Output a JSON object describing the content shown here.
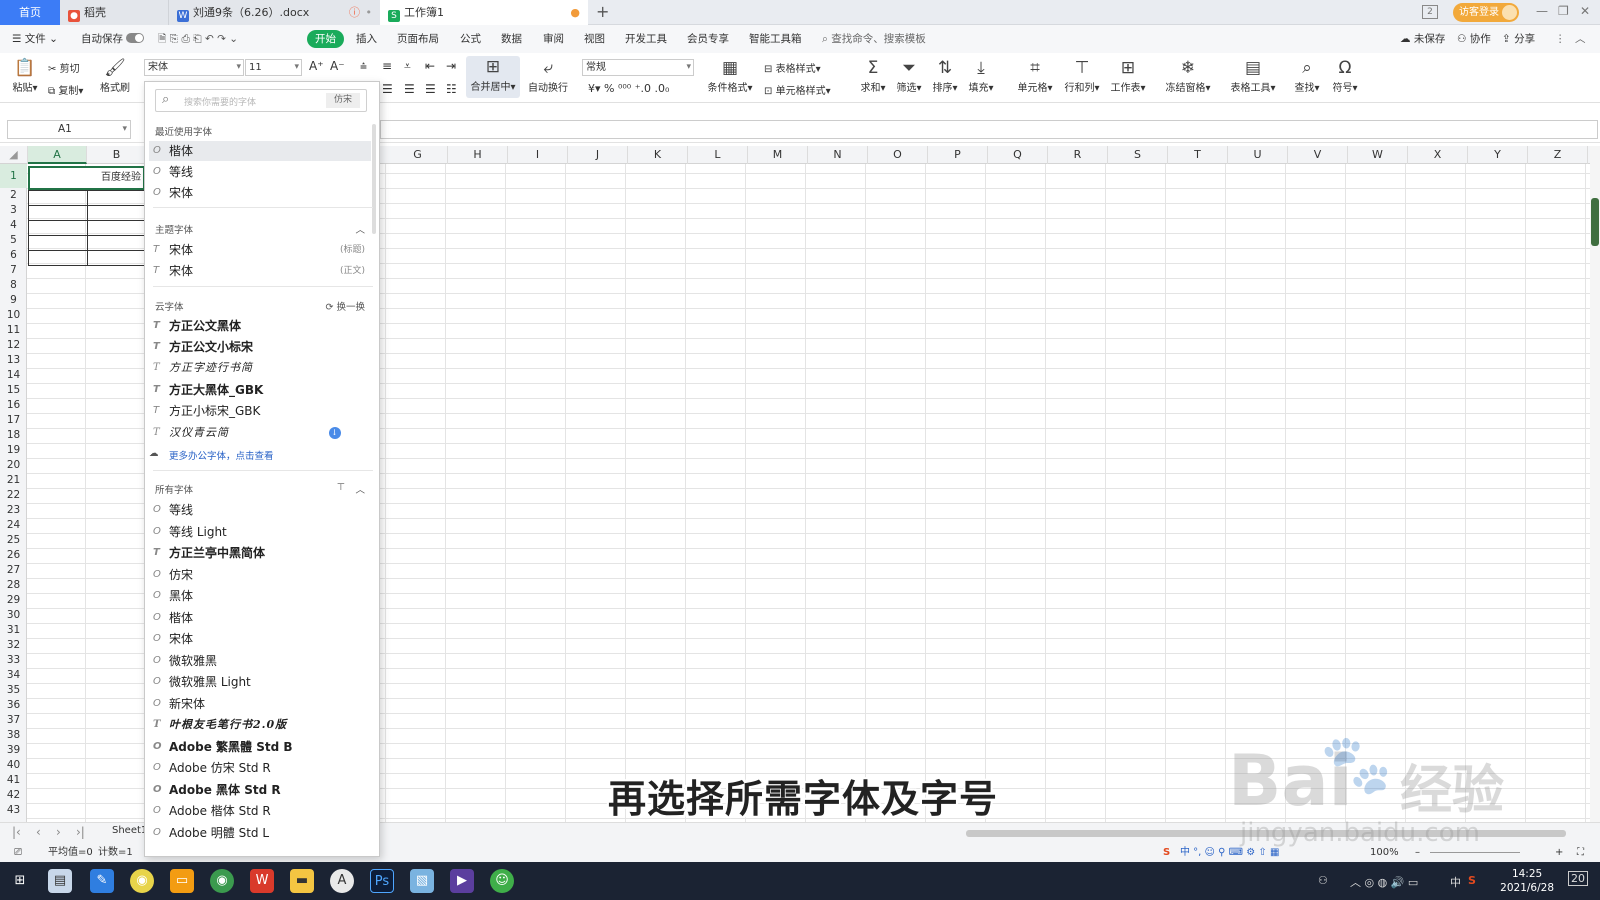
{
  "tabs": {
    "home": "首页",
    "dao": "稻壳",
    "doc": "刘通9条（6.26）.docx",
    "workbook": "工作簿1",
    "new_tab": "+"
  },
  "window": {
    "login": "访客登录",
    "minimize": "—",
    "restore": "❐",
    "close": "✕"
  },
  "menubar": {
    "file": "文件",
    "autosave": "自动保存",
    "items": [
      "开始",
      "插入",
      "页面布局",
      "公式",
      "数据",
      "审阅",
      "视图",
      "开发工具",
      "会员专享",
      "智能工具箱"
    ],
    "search": "查找命令、搜索模板",
    "unsaved": "未保存",
    "collab": "协作",
    "share": "分享"
  },
  "ribbon": {
    "paste": "粘贴",
    "cut": "剪切",
    "copy": "复制",
    "format_painter": "格式刷",
    "font_name": "宋体",
    "font_size": "11",
    "merge_center": "合并居中",
    "auto_wrap": "自动换行",
    "number_format": "常规",
    "conditional_format": "条件格式",
    "table_style": "表格样式",
    "cell_style": "单元格样式",
    "sum": "求和",
    "filter": "筛选",
    "sort": "排序",
    "fill": "填充",
    "cell": "单元格",
    "row_col": "行和列",
    "worksheet": "工作表",
    "freeze": "冻结窗格",
    "table_tools": "表格工具",
    "find": "查找",
    "symbol": "符号"
  },
  "namebox": "A1",
  "columns": [
    "A",
    "B",
    "G",
    "H",
    "I",
    "J",
    "K",
    "L",
    "M",
    "N",
    "O",
    "P",
    "Q",
    "R",
    "S",
    "T",
    "U",
    "V",
    "W",
    "X",
    "Y",
    "Z"
  ],
  "rows": [
    "1",
    "2",
    "3",
    "4",
    "5",
    "6",
    "7",
    "8",
    "9",
    "10",
    "11",
    "12",
    "13",
    "14",
    "15",
    "16",
    "17",
    "18",
    "19",
    "20",
    "21",
    "22",
    "23",
    "24",
    "25",
    "26",
    "27",
    "28",
    "29",
    "30",
    "31",
    "32",
    "33",
    "34",
    "35",
    "36",
    "37",
    "38",
    "39",
    "40",
    "41",
    "42",
    "43"
  ],
  "cell_a1": "百度经验",
  "font_panel": {
    "search_placeholder": "搜索你需要的字体",
    "preview": "仿宋",
    "recent_title": "最近使用字体",
    "recent": [
      "楷体",
      "等线",
      "宋体"
    ],
    "theme_title": "主题字体",
    "theme": [
      {
        "name": "宋体",
        "tag": "(标题)"
      },
      {
        "name": "宋体",
        "tag": "(正文)"
      }
    ],
    "cloud_title": "云字体",
    "cloud_refresh": "换一换",
    "cloud": [
      "方正公文黑体",
      "方正公文小标宋",
      "方正字迹行书简",
      "方正大黑体_GBK",
      "方正小标宋_GBK",
      "汉仪青云简"
    ],
    "more_link": "更多办公字体，点击查看",
    "all_title": "所有字体",
    "all": [
      "等线",
      "等线 Light",
      "方正兰亭中黑简体",
      "仿宋",
      "黑体",
      "楷体",
      "宋体",
      "微软雅黑",
      "微软雅黑 Light",
      "新宋体",
      "叶根友毛笔行书2.0版",
      "Adobe 繁黑體 Std B",
      "Adobe 仿宋 Std R",
      "Adobe 黑体 Std R",
      "Adobe 楷体 Std R",
      "Adobe 明體 Std L"
    ]
  },
  "sheet": {
    "name": "Sheet1"
  },
  "status": {
    "avg": "平均值=0",
    "count": "计数=1",
    "zoom": "100%"
  },
  "taskbar": {
    "time": "14:25",
    "date": "2021/6/28",
    "ime": "中",
    "notif": "20"
  },
  "caption": "再选择所需字体及字号",
  "watermark": {
    "brand": "Bai",
    "brand2": "经验",
    "url": "jingyan.baidu.com"
  }
}
